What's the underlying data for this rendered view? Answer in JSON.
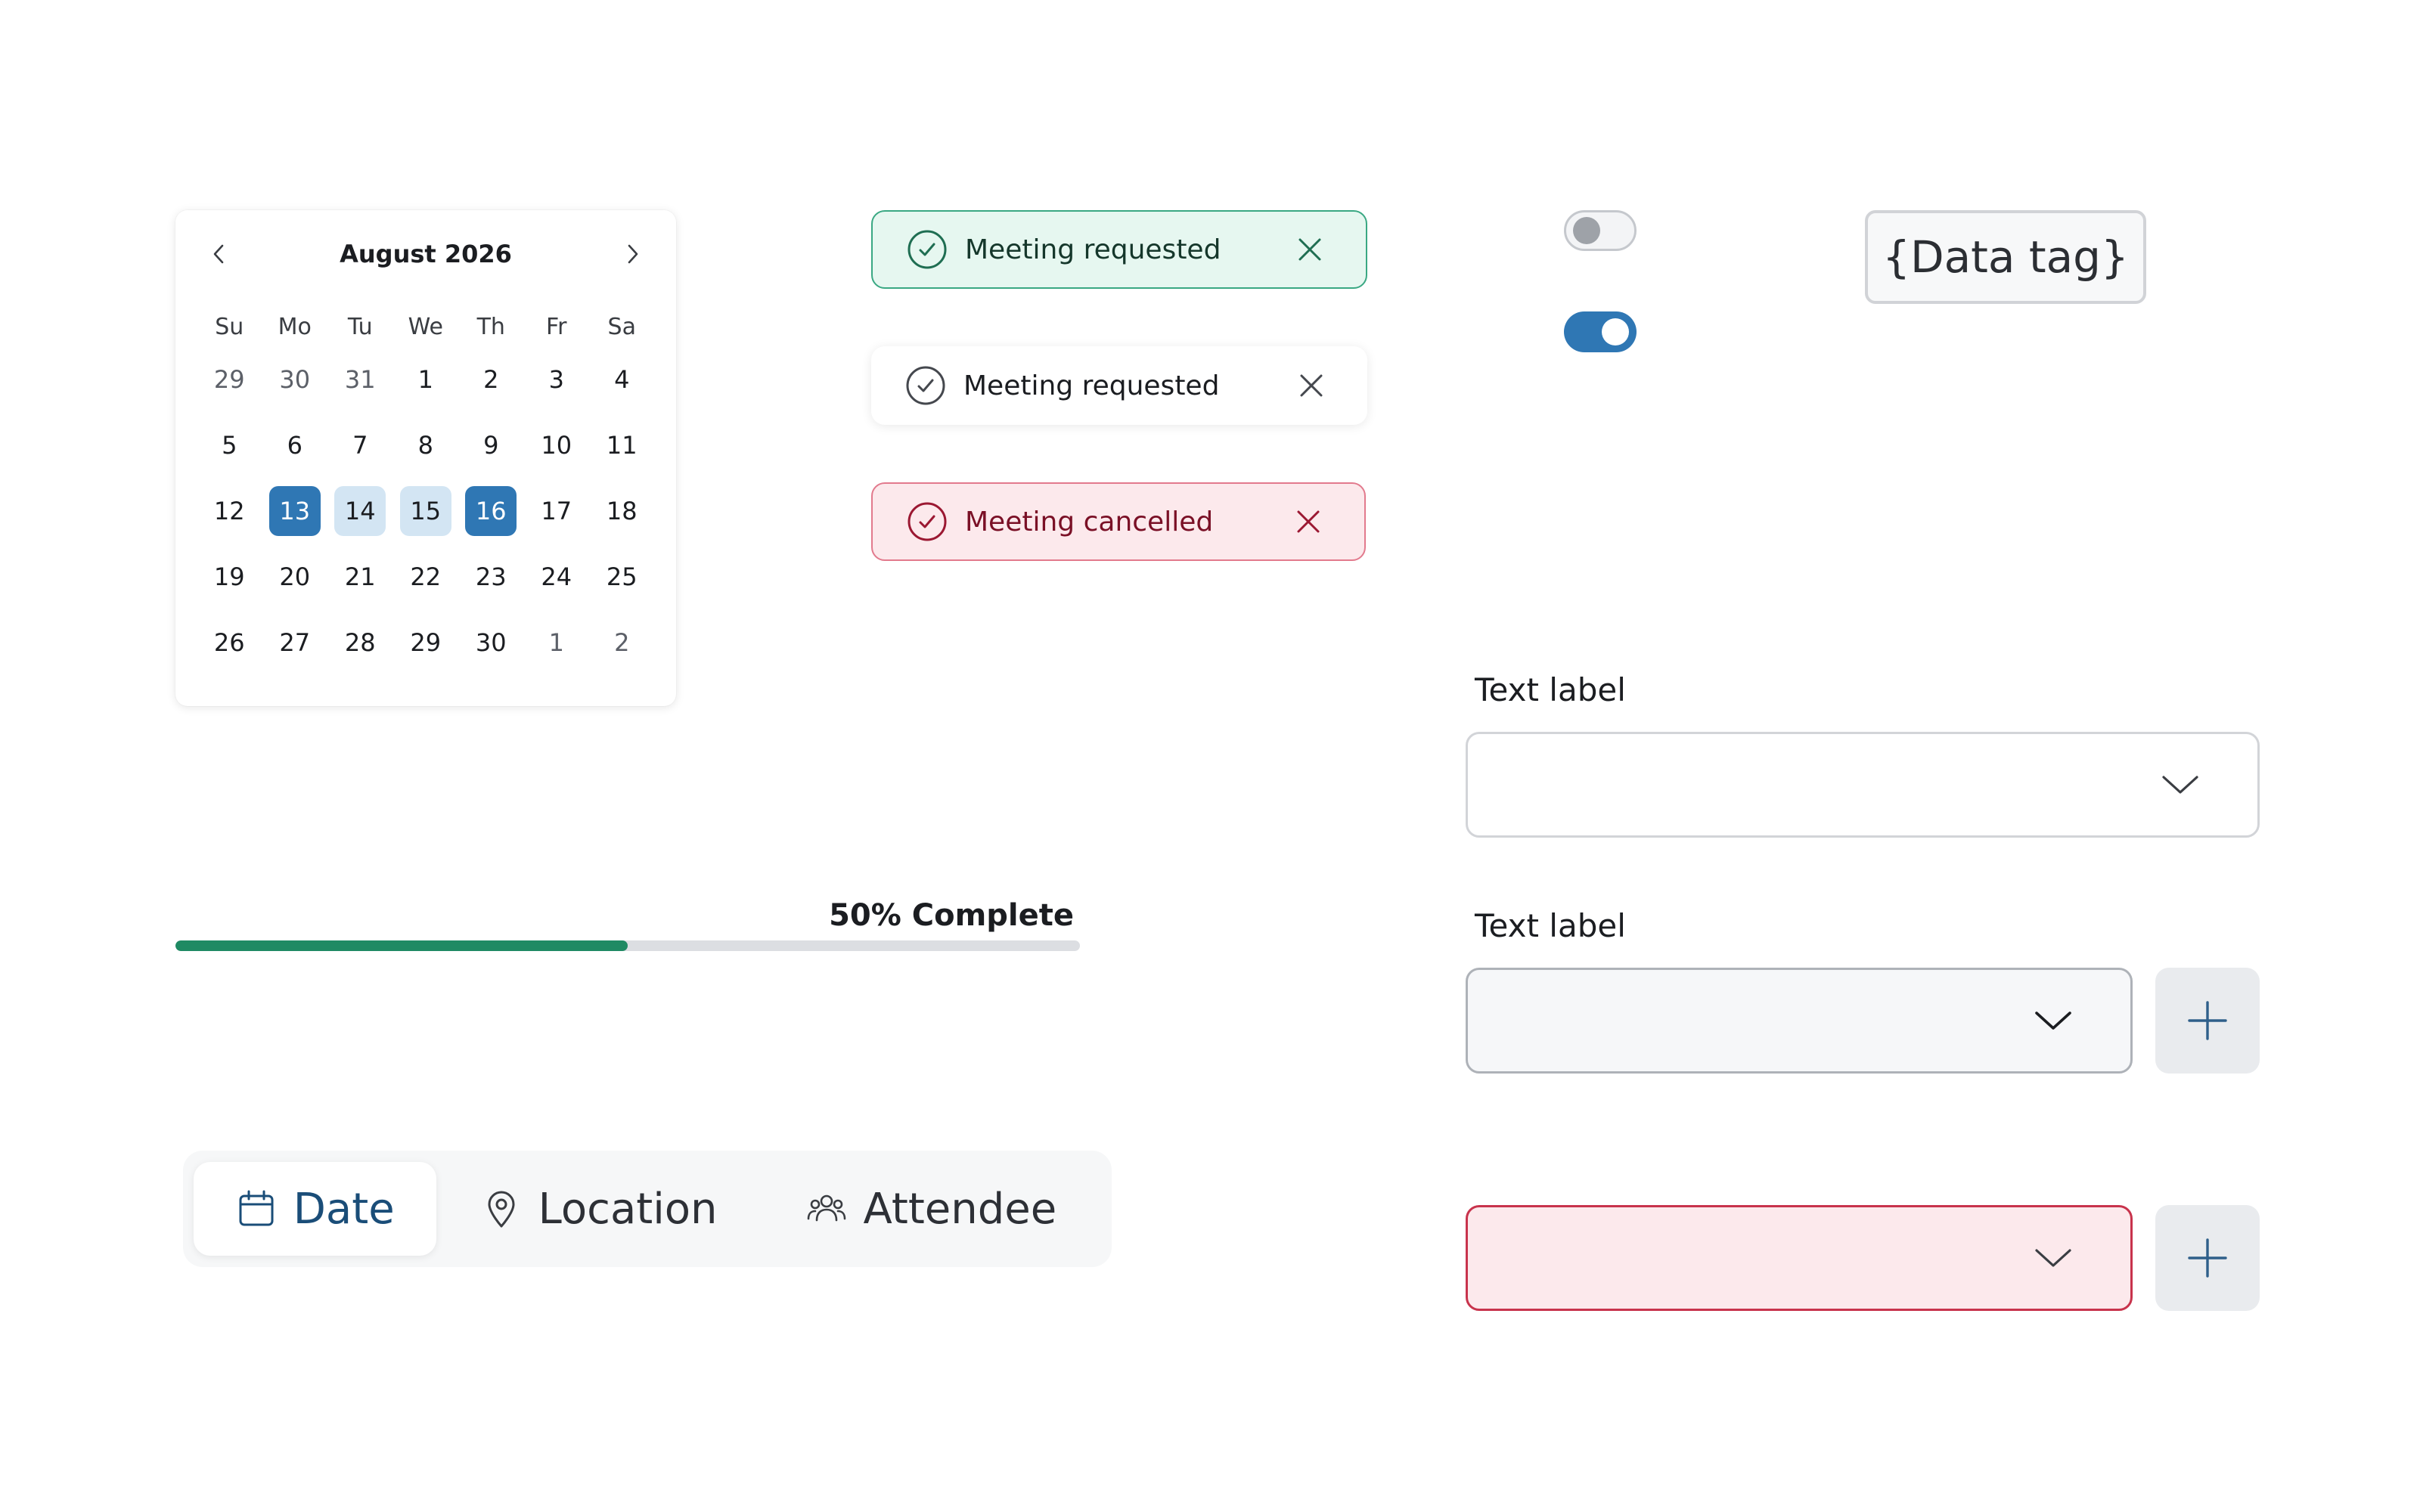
{
  "calendar": {
    "title": "August 2026",
    "weekdays": [
      "Su",
      "Mo",
      "Tu",
      "We",
      "Th",
      "Fr",
      "Sa"
    ],
    "weeks": [
      [
        "29",
        "30",
        "31",
        "1",
        "2",
        "3",
        "4"
      ],
      [
        "5",
        "6",
        "7",
        "8",
        "9",
        "10",
        "11"
      ],
      [
        "12",
        "13",
        "14",
        "15",
        "16",
        "17",
        "18"
      ],
      [
        "19",
        "20",
        "21",
        "22",
        "23",
        "24",
        "25"
      ],
      [
        "26",
        "27",
        "28",
        "29",
        "30",
        "1",
        "2"
      ]
    ],
    "selected_start": "13",
    "selected_end": "16",
    "accent_color": "#2f77b4",
    "range_color": "#d3e5f3"
  },
  "toasts": [
    {
      "variant": "success",
      "message": "Meeting requested",
      "icon": "check-circle-icon",
      "close_icon": "close-icon"
    },
    {
      "variant": "neutral",
      "message": "Meeting requested",
      "icon": "check-circle-icon",
      "close_icon": "close-icon"
    },
    {
      "variant": "error",
      "message": "Meeting cancelled",
      "icon": "check-circle-icon",
      "close_icon": "close-icon"
    }
  ],
  "toggles": [
    {
      "state": "off"
    },
    {
      "state": "on"
    }
  ],
  "data_tag": {
    "text": "{Data tag}"
  },
  "progress": {
    "label": "50% Complete",
    "value": 0.5,
    "color": "#1f8a63"
  },
  "tabs": [
    {
      "label": "Date",
      "icon": "calendar-icon",
      "active": true
    },
    {
      "label": "Location",
      "icon": "location-pin-icon",
      "active": false
    },
    {
      "label": "Attendee",
      "icon": "people-icon",
      "active": false
    }
  ],
  "fields": {
    "field1": {
      "label": "Text label",
      "value": "",
      "icon": "chevron-down-icon"
    },
    "field2": {
      "label": "Text label",
      "value": "",
      "icon": "chevron-down-icon",
      "add_icon": "plus-icon"
    },
    "field3": {
      "value": "",
      "state": "error",
      "icon": "chevron-down-icon",
      "add_icon": "plus-icon"
    }
  }
}
